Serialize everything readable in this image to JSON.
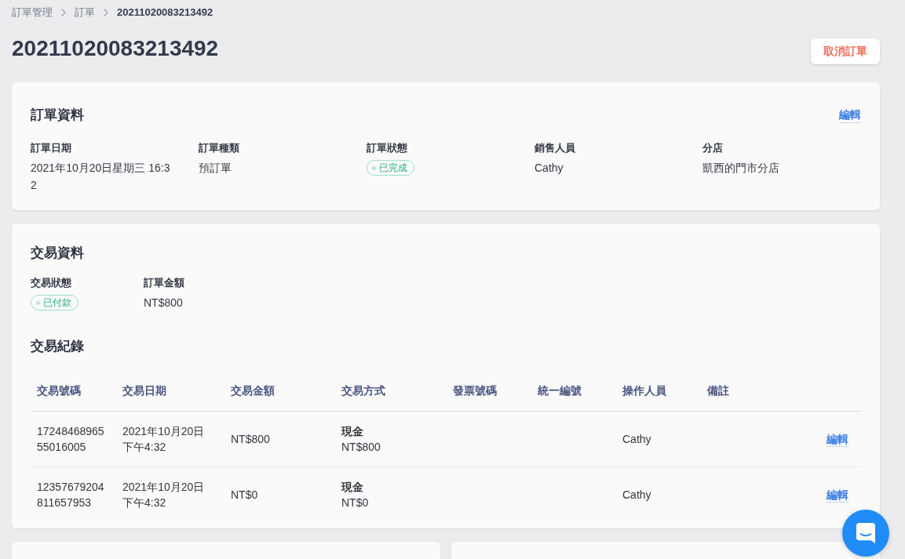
{
  "breadcrumb": [
    {
      "label": "訂單管理",
      "current": false
    },
    {
      "label": "訂單",
      "current": false
    },
    {
      "label": "20211020083213492",
      "current": true
    }
  ],
  "page_title": "20211020083213492",
  "cancel_button": "取消訂單",
  "order_info": {
    "title": "訂單資料",
    "edit_link": "編輯",
    "fields": [
      {
        "label": "訂單日期",
        "value": "2021年10月20日星期三 16:32",
        "kind": "text"
      },
      {
        "label": "訂單種類",
        "value": "預訂單",
        "kind": "text"
      },
      {
        "label": "訂單狀態",
        "value": "已完成",
        "kind": "badge"
      },
      {
        "label": "銷售人員",
        "value": "Cathy",
        "kind": "text"
      },
      {
        "label": "分店",
        "value": "凱西的門市分店",
        "kind": "text"
      }
    ]
  },
  "transaction_info": {
    "title": "交易資料",
    "fields": [
      {
        "label": "交易狀態",
        "value": "已付款",
        "kind": "badge"
      },
      {
        "label": "訂單金額",
        "value": "NT$800",
        "kind": "text"
      }
    ]
  },
  "transaction_records": {
    "title": "交易紀錄",
    "columns": [
      "交易號碼",
      "交易日期",
      "交易金額",
      "交易方式",
      "發票號碼",
      "統一編號",
      "操作人員",
      "備註"
    ],
    "rows": [
      {
        "transaction_no": "1724846896555016005",
        "date": "2021年10月20日下午4:32",
        "amount": "NT$800",
        "method": {
          "name": "現金",
          "amount": "NT$800"
        },
        "operator": "Cathy",
        "edit_link": "編輯"
      },
      {
        "transaction_no": "12357679204811657953",
        "date": "2021年10月20日下午4:32",
        "amount": "NT$0",
        "method": {
          "name": "現金",
          "amount": "NT$0"
        },
        "operator": "Cathy",
        "edit_link": "編輯"
      }
    ]
  }
}
